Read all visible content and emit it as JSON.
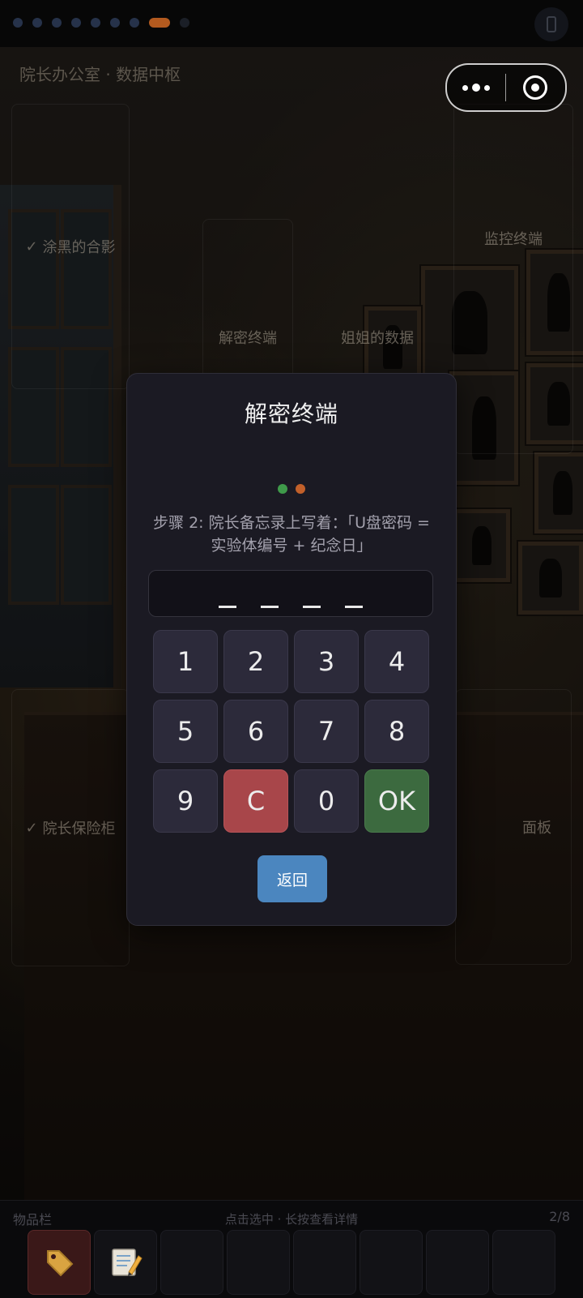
{
  "header": {
    "progress": {
      "total": 10,
      "active_index": 7,
      "future_index": 9
    },
    "scene_title": "院长办公室 · 数据中枢"
  },
  "hotspots": {
    "photo": "涂黑的合影",
    "decrypt_terminal": "解密终端",
    "sister_data": "姐姐的数据",
    "monitor_terminal": "监控终端",
    "safe": "院长保险柜",
    "panel": "面板",
    "check_mark": "✓"
  },
  "modal": {
    "title": "解密终端",
    "step_dots": [
      "#3f9a4a",
      "#c2602a"
    ],
    "step_text": "步骤 2: 院长备忘录上写着：「U盘密码 = 实验体编号 + 纪念日」",
    "code_slots": 4,
    "keys": [
      "1",
      "2",
      "3",
      "4",
      "5",
      "6",
      "7",
      "8",
      "9",
      "C",
      "0",
      "OK"
    ],
    "back_label": "返回"
  },
  "inventory": {
    "label": "物品栏",
    "hint": "点击选中 · 长按查看详情",
    "count": "2/8",
    "items": [
      "tag-icon",
      "memo-icon",
      "",
      "",
      "",
      "",
      "",
      ""
    ]
  }
}
